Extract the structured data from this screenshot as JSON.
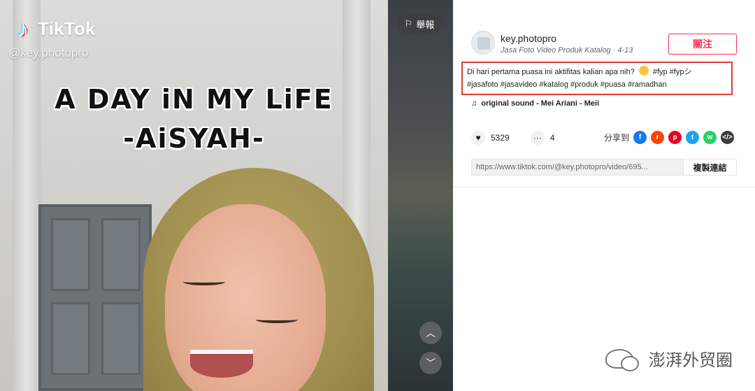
{
  "video": {
    "brand": "TikTok",
    "handle": "@key.photopro",
    "overlay_line1": "A DAY iN MY LiFE",
    "overlay_line2": "-AiSYAH-",
    "report_label": "舉報",
    "nav_up_icon": "chevron-up-icon",
    "nav_down_icon": "chevron-down-icon"
  },
  "author": {
    "username": "key.photopro",
    "subtitle": "Jasa Foto Video Produk Katalog · 4-13",
    "follow_label": "關注"
  },
  "caption": {
    "text_before_emoji": "Di hari pertama puasa ini aktifitas kalian apa nih?",
    "text_after_emoji": " #fyp #fypシ",
    "line2": "#jasafoto #jasavideo #katalog #produk #puasa #ramadhan"
  },
  "sound": {
    "label": "original sound - Mei Ariani - Meii"
  },
  "stats": {
    "likes": "5329",
    "comments": "4"
  },
  "share": {
    "label": "分享到",
    "targets": [
      {
        "name": "facebook",
        "color": "#1877f2",
        "glyph": "f"
      },
      {
        "name": "reddit",
        "color": "#ff4500",
        "glyph": "r"
      },
      {
        "name": "pinterest",
        "color": "#e60023",
        "glyph": "p"
      },
      {
        "name": "twitter",
        "color": "#1da1f2",
        "glyph": "t"
      },
      {
        "name": "whatsapp",
        "color": "#25d366",
        "glyph": "w"
      },
      {
        "name": "embed",
        "color": "#3b3b3b",
        "glyph": "<>"
      }
    ]
  },
  "link": {
    "url": "https://www.tiktok.com/@key.photopro/video/695...",
    "copy_label": "複製連結"
  },
  "watermark": {
    "text": "澎湃外贸圈"
  }
}
